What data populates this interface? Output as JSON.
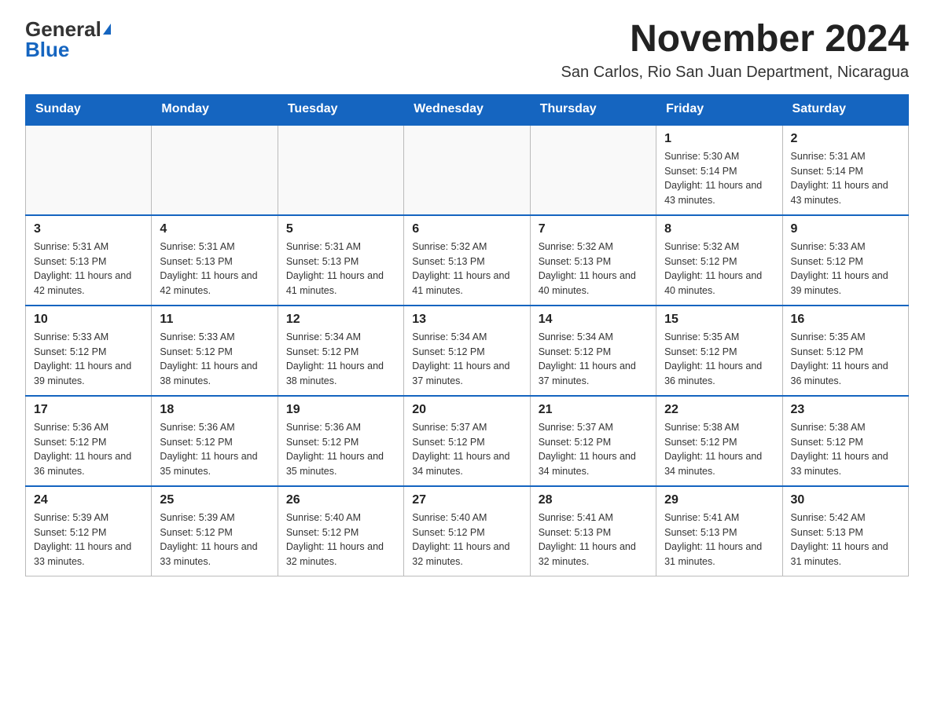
{
  "logo": {
    "general": "General",
    "blue": "Blue"
  },
  "header": {
    "month_year": "November 2024",
    "location": "San Carlos, Rio San Juan Department, Nicaragua"
  },
  "weekdays": [
    "Sunday",
    "Monday",
    "Tuesday",
    "Wednesday",
    "Thursday",
    "Friday",
    "Saturday"
  ],
  "weeks": [
    [
      {
        "day": "",
        "info": ""
      },
      {
        "day": "",
        "info": ""
      },
      {
        "day": "",
        "info": ""
      },
      {
        "day": "",
        "info": ""
      },
      {
        "day": "",
        "info": ""
      },
      {
        "day": "1",
        "info": "Sunrise: 5:30 AM\nSunset: 5:14 PM\nDaylight: 11 hours and 43 minutes."
      },
      {
        "day": "2",
        "info": "Sunrise: 5:31 AM\nSunset: 5:14 PM\nDaylight: 11 hours and 43 minutes."
      }
    ],
    [
      {
        "day": "3",
        "info": "Sunrise: 5:31 AM\nSunset: 5:13 PM\nDaylight: 11 hours and 42 minutes."
      },
      {
        "day": "4",
        "info": "Sunrise: 5:31 AM\nSunset: 5:13 PM\nDaylight: 11 hours and 42 minutes."
      },
      {
        "day": "5",
        "info": "Sunrise: 5:31 AM\nSunset: 5:13 PM\nDaylight: 11 hours and 41 minutes."
      },
      {
        "day": "6",
        "info": "Sunrise: 5:32 AM\nSunset: 5:13 PM\nDaylight: 11 hours and 41 minutes."
      },
      {
        "day": "7",
        "info": "Sunrise: 5:32 AM\nSunset: 5:13 PM\nDaylight: 11 hours and 40 minutes."
      },
      {
        "day": "8",
        "info": "Sunrise: 5:32 AM\nSunset: 5:12 PM\nDaylight: 11 hours and 40 minutes."
      },
      {
        "day": "9",
        "info": "Sunrise: 5:33 AM\nSunset: 5:12 PM\nDaylight: 11 hours and 39 minutes."
      }
    ],
    [
      {
        "day": "10",
        "info": "Sunrise: 5:33 AM\nSunset: 5:12 PM\nDaylight: 11 hours and 39 minutes."
      },
      {
        "day": "11",
        "info": "Sunrise: 5:33 AM\nSunset: 5:12 PM\nDaylight: 11 hours and 38 minutes."
      },
      {
        "day": "12",
        "info": "Sunrise: 5:34 AM\nSunset: 5:12 PM\nDaylight: 11 hours and 38 minutes."
      },
      {
        "day": "13",
        "info": "Sunrise: 5:34 AM\nSunset: 5:12 PM\nDaylight: 11 hours and 37 minutes."
      },
      {
        "day": "14",
        "info": "Sunrise: 5:34 AM\nSunset: 5:12 PM\nDaylight: 11 hours and 37 minutes."
      },
      {
        "day": "15",
        "info": "Sunrise: 5:35 AM\nSunset: 5:12 PM\nDaylight: 11 hours and 36 minutes."
      },
      {
        "day": "16",
        "info": "Sunrise: 5:35 AM\nSunset: 5:12 PM\nDaylight: 11 hours and 36 minutes."
      }
    ],
    [
      {
        "day": "17",
        "info": "Sunrise: 5:36 AM\nSunset: 5:12 PM\nDaylight: 11 hours and 36 minutes."
      },
      {
        "day": "18",
        "info": "Sunrise: 5:36 AM\nSunset: 5:12 PM\nDaylight: 11 hours and 35 minutes."
      },
      {
        "day": "19",
        "info": "Sunrise: 5:36 AM\nSunset: 5:12 PM\nDaylight: 11 hours and 35 minutes."
      },
      {
        "day": "20",
        "info": "Sunrise: 5:37 AM\nSunset: 5:12 PM\nDaylight: 11 hours and 34 minutes."
      },
      {
        "day": "21",
        "info": "Sunrise: 5:37 AM\nSunset: 5:12 PM\nDaylight: 11 hours and 34 minutes."
      },
      {
        "day": "22",
        "info": "Sunrise: 5:38 AM\nSunset: 5:12 PM\nDaylight: 11 hours and 34 minutes."
      },
      {
        "day": "23",
        "info": "Sunrise: 5:38 AM\nSunset: 5:12 PM\nDaylight: 11 hours and 33 minutes."
      }
    ],
    [
      {
        "day": "24",
        "info": "Sunrise: 5:39 AM\nSunset: 5:12 PM\nDaylight: 11 hours and 33 minutes."
      },
      {
        "day": "25",
        "info": "Sunrise: 5:39 AM\nSunset: 5:12 PM\nDaylight: 11 hours and 33 minutes."
      },
      {
        "day": "26",
        "info": "Sunrise: 5:40 AM\nSunset: 5:12 PM\nDaylight: 11 hours and 32 minutes."
      },
      {
        "day": "27",
        "info": "Sunrise: 5:40 AM\nSunset: 5:12 PM\nDaylight: 11 hours and 32 minutes."
      },
      {
        "day": "28",
        "info": "Sunrise: 5:41 AM\nSunset: 5:13 PM\nDaylight: 11 hours and 32 minutes."
      },
      {
        "day": "29",
        "info": "Sunrise: 5:41 AM\nSunset: 5:13 PM\nDaylight: 11 hours and 31 minutes."
      },
      {
        "day": "30",
        "info": "Sunrise: 5:42 AM\nSunset: 5:13 PM\nDaylight: 11 hours and 31 minutes."
      }
    ]
  ]
}
